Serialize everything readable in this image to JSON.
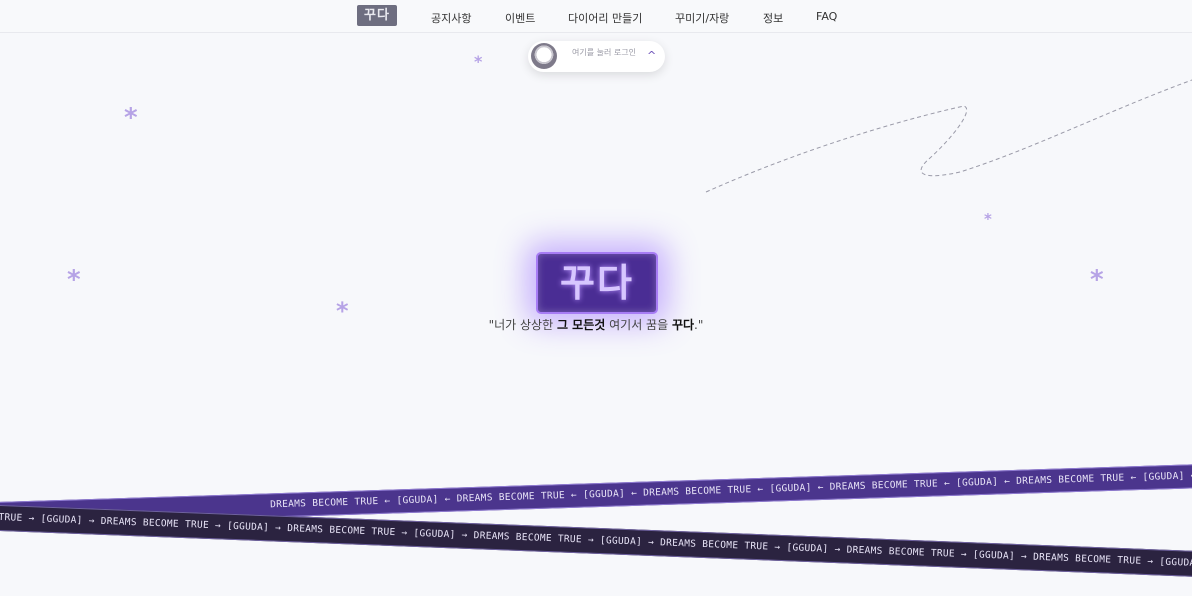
{
  "nav": {
    "logo_text": "꾸다",
    "items": [
      {
        "label": "공지사항"
      },
      {
        "label": "이벤트"
      },
      {
        "label": "다이어리 만들기"
      },
      {
        "label": "꾸미기/자랑"
      },
      {
        "label": "정보"
      },
      {
        "label": "FAQ"
      }
    ]
  },
  "login": {
    "text": "여기를 눌러 로그인",
    "chevron": "^"
  },
  "hero": {
    "logo_text": "꾸다",
    "tagline_pre": "\"너가 상상한 ",
    "tagline_bold1": "그 모든것",
    "tagline_mid": " 여기서 꿈을 ",
    "tagline_bold2": "꾸다",
    "tagline_post": ".\""
  },
  "ribbons": {
    "top_text": "DREAMS BECOME TRUE ← [GGUDA] ← DREAMS BECOME TRUE ← [GGUDA] ← DREAMS BECOME TRUE ← [GGUDA] ← DREAMS BECOME TRUE ← [GGUDA] ← DREAMS BECOME TRUE ← [GGUDA] ← DREAMS BECOME TRUE ← [GGUDA] ← DREAMS BECOME TRUE ← [GGUDA] ← DREAMS BECOME TRUE",
    "bottom_text": "TRUE → [GGUDA] → DREAMS BECOME TRUE → [GGUDA] → DREAMS BECOME TRUE → [GGUDA] → DREAMS BECOME TRUE → [GGUDA] → DREAMS BECOME TRUE → [GGUDA] → DREAMS BECOME TRUE → [GGUDA] → DREAMS BECOME TRUE → [GGUDA] → DREAMS BECOME TRUE → [GGUDA]"
  },
  "colors": {
    "accent": "#6b50b8",
    "star": "#b6a3e6",
    "ribbon_top": "#4b358d",
    "ribbon_bottom": "#2b2340"
  },
  "icons": {
    "star": "asterisk-star-icon",
    "avatar": "avatar-icon"
  }
}
